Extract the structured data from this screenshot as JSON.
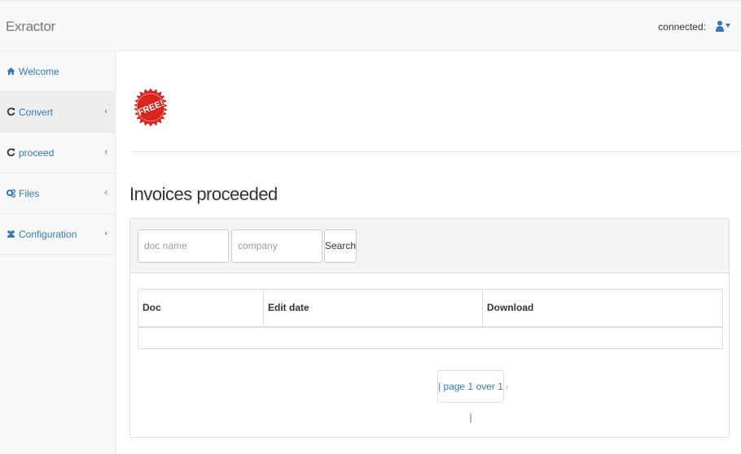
{
  "navbar": {
    "brand": "Exractor",
    "connected_label": "connected:",
    "user_icon": "user-icon",
    "caret_icon": "caret-down-icon"
  },
  "sidebar": {
    "items": [
      {
        "label": "Welcome",
        "icon": "home-icon",
        "active": false,
        "has_chevron": false
      },
      {
        "label": "Convert",
        "icon": "refresh-icon",
        "active": true,
        "has_chevron": true
      },
      {
        "label": "proceed",
        "icon": "refresh-icon",
        "active": false,
        "has_chevron": true
      },
      {
        "label": "Files",
        "icon": "gears-icon",
        "active": false,
        "has_chevron": true
      },
      {
        "label": "Configuration",
        "icon": "users-icon",
        "active": false,
        "has_chevron": true
      }
    ],
    "chevron": "‹"
  },
  "main": {
    "badge_text": "FREE!",
    "title": "Invoices proceeded",
    "search": {
      "doc_placeholder": "doc name",
      "company_placeholder": "company",
      "button_label": "Search"
    },
    "table": {
      "columns": [
        "Doc",
        "Edit date",
        "Download"
      ],
      "rows": []
    },
    "pager": "| page 1 over 1 |"
  },
  "colors": {
    "link": "#337ab7",
    "badge_red": "#d9251d",
    "navbar_bg": "#f8f8f8"
  }
}
